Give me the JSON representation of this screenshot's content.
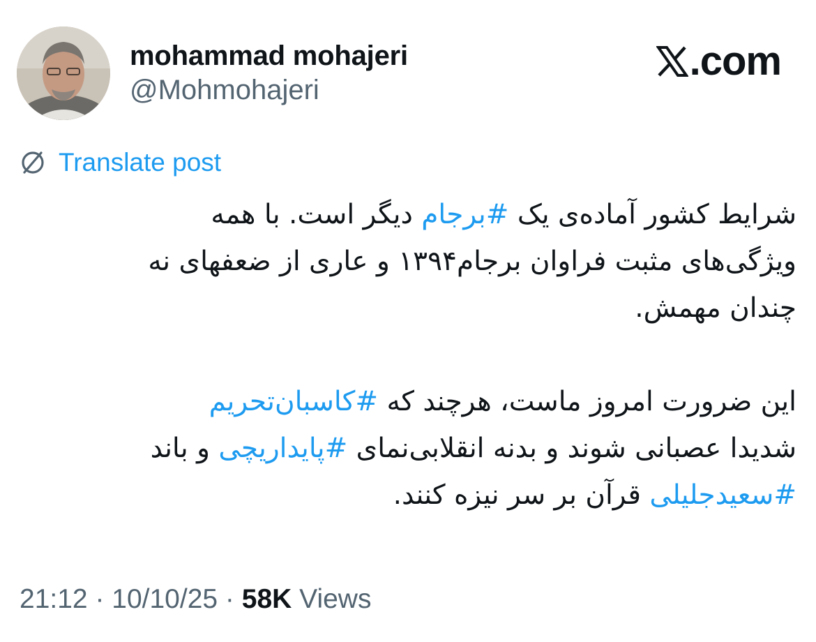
{
  "author": {
    "display_name": "mohammad mohajeri",
    "handle": "@Mohmohajeri"
  },
  "brand": {
    "text": ".com",
    "icon": "x-logo-icon"
  },
  "translate": {
    "label": "Translate post",
    "icon": "translate-globe-icon"
  },
  "tweet": {
    "paragraph1": {
      "line1": {
        "a": "شرایط کشور آماده‌ی یک ",
        "hashtag": "#برجام",
        "b": " دیگر است. با همه"
      },
      "line2": "ویژگی‌های مثبت فراوان برجام۱۳۹۴ و عاری از ضعفهای نه",
      "line3": "چندان مهمش."
    },
    "paragraph2": {
      "line1": {
        "a": "این ضرورت امروز ماست، هرچند که ",
        "hashtag": "#کاسبان‌تحریم"
      },
      "line2": {
        "a": "شدیدا عصبانی شوند و بدنه انقلابی‌نمای ",
        "hashtag": "#پایداریچی",
        "b": " و باند"
      },
      "line3": {
        "hashtag": "#سعیدجلیلی",
        "b": " قرآن بر سر نیزه کنند."
      }
    }
  },
  "meta": {
    "time": "21:12",
    "separator": " · ",
    "date": "10/10/25",
    "views_count": "58K",
    "views_label": " Views"
  },
  "colors": {
    "link": "#1d9bf0",
    "text": "#0f1419",
    "muted": "#536471"
  }
}
